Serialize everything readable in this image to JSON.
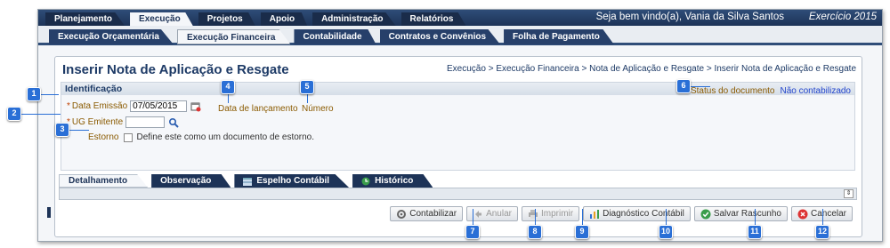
{
  "topnav": {
    "tabs": [
      "Planejamento",
      "Execução",
      "Projetos",
      "Apoio",
      "Administração",
      "Relatórios"
    ],
    "active": "Execução",
    "welcome": "Seja bem vindo(a), Vania da Silva Santos",
    "exercise": "Exercício 2015"
  },
  "subnav": {
    "tabs": [
      "Execução Orçamentária",
      "Execução Financeira",
      "Contabilidade",
      "Contratos e Convênios",
      "Folha de Pagamento"
    ],
    "active": "Execução Financeira"
  },
  "page": {
    "title": "Inserir Nota de Aplicação e Resgate",
    "breadcrumb": "Execução > Execução Financeira > Nota de Aplicação e Resgate > Inserir Nota de Aplicação e Resgate"
  },
  "identificacao": {
    "header": "Identificação",
    "data_emissao_label": "Data Emissão",
    "data_emissao_value": "07/05/2015",
    "ug_emitente_label": "UG Emitente",
    "ug_emitente_value": "",
    "data_lancamento_label": "Data de lançamento",
    "numero_label": "Número",
    "status_label": "Status do documento",
    "status_value": "Não contabilizado",
    "estorno_label": "Estorno",
    "estorno_checkbox_label": "Define este como um documento de estorno.",
    "required_mark": "*"
  },
  "detail_tabs": [
    "Detalhamento",
    "Observação",
    "Espelho Contábil",
    "Histórico"
  ],
  "detail_active": "Detalhamento",
  "scroll_symbol": "⇕",
  "buttons": {
    "contabilizar": "Contabilizar",
    "anular": "Anular",
    "imprimir": "Imprimir",
    "diagnostico": "Diagnóstico Contábil",
    "salvar": "Salvar Rascunho",
    "cancelar": "Cancelar"
  },
  "callouts": [
    "1",
    "2",
    "3",
    "4",
    "5",
    "6",
    "7",
    "8",
    "9",
    "10",
    "11",
    "12"
  ],
  "colors": {
    "brand": "#1d3357",
    "callout": "#2a6fd6",
    "link": "#2244cc",
    "label": "#8a5a00"
  }
}
